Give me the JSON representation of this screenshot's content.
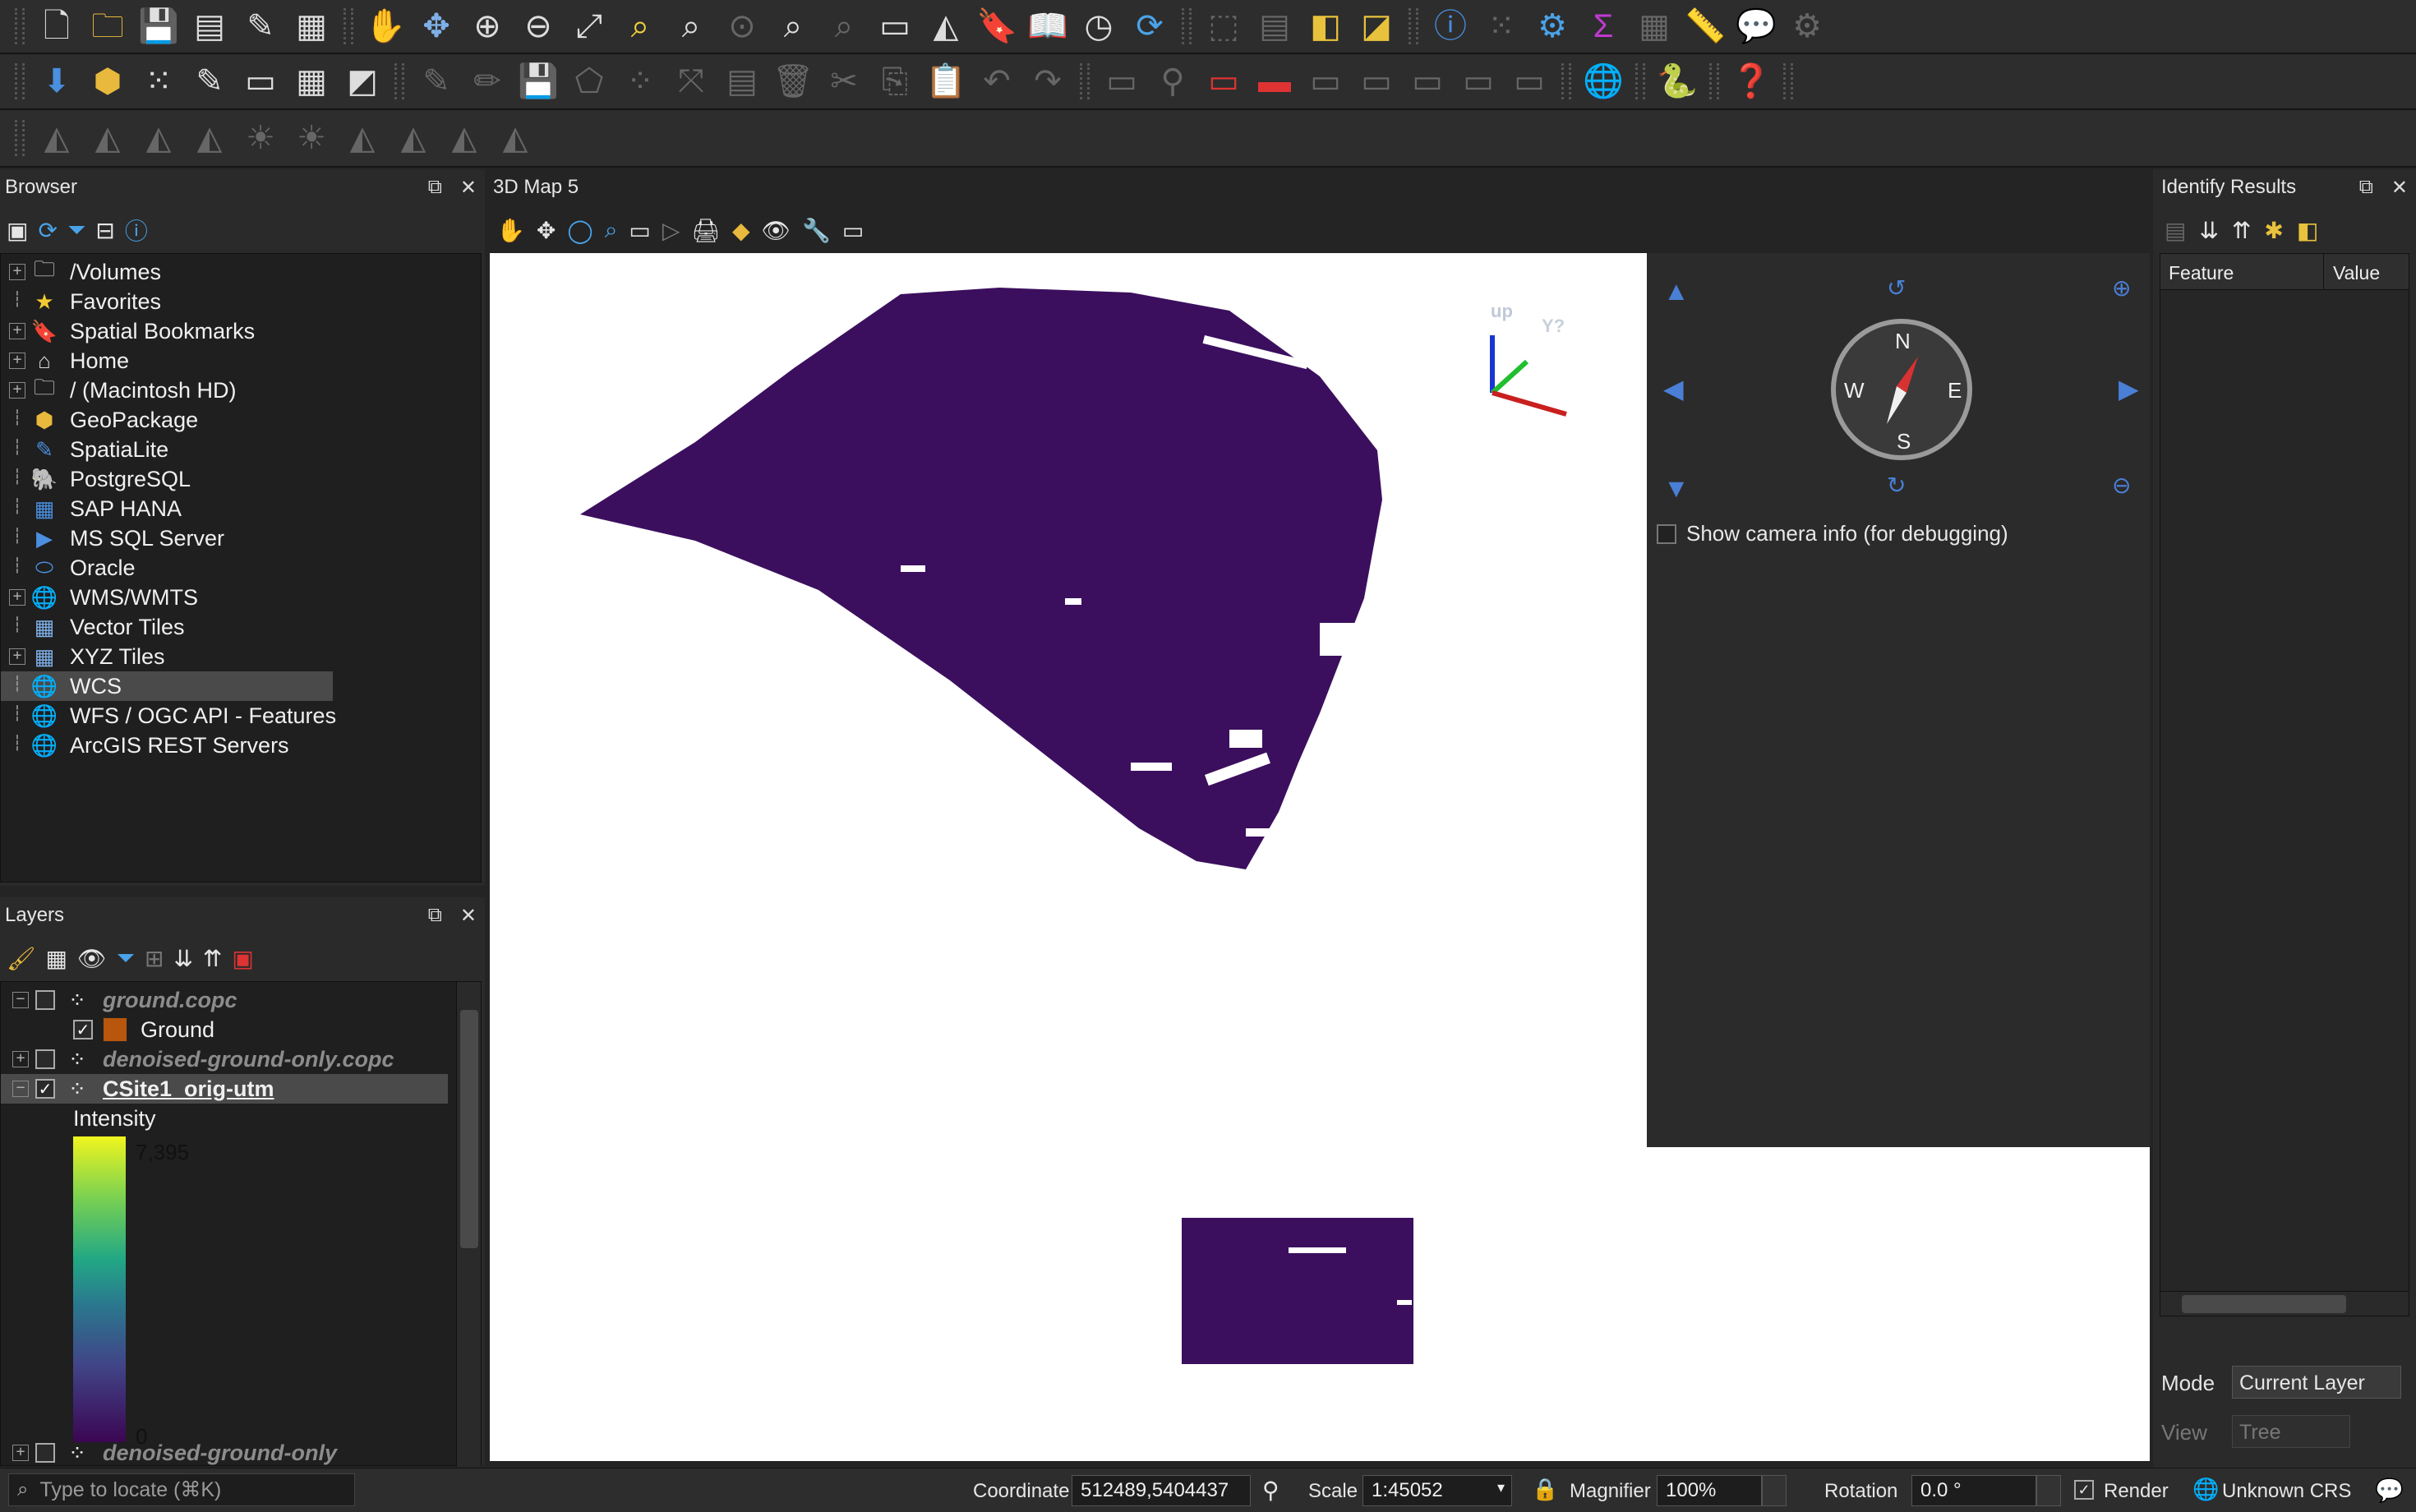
{
  "toolbar_rows": [
    {
      "icons": [
        "new-project-icon",
        "open-project-icon",
        "save-project-icon",
        "new-print-layout-icon",
        "style-manager-icon",
        "pan-map-icon",
        "pan-to-selection-icon",
        "zoom-in-icon",
        "zoom-out-icon",
        "zoom-full-icon",
        "zoom-to-layer-icon",
        "zoom-to-selection-icon",
        "zoom-native-icon",
        "zoom-last-icon",
        "zoom-next-icon",
        "new-map-view-icon",
        "new-3d-map-view-icon",
        "bookmark-icon",
        "show-bookmarks-icon",
        "temporal-controller-icon",
        "refresh-icon",
        "select-features-icon",
        "attribute-table-icon",
        "deselect-icon",
        "select-by-location-icon",
        "identify-icon",
        "measure-icon",
        "statistics-icon",
        "sum-icon",
        "open-field-calculator-icon",
        "ruler-icon",
        "map-tips-icon",
        "processing-icon"
      ]
    }
  ],
  "browser": {
    "title": "Browser",
    "items": [
      {
        "label": "/Volumes",
        "icon": "folder-icon",
        "expandable": true
      },
      {
        "label": "Favorites",
        "icon": "star-icon",
        "expandable": false
      },
      {
        "label": "Spatial Bookmarks",
        "icon": "bookmark-icon",
        "expandable": true
      },
      {
        "label": "Home",
        "icon": "home-icon",
        "expandable": true
      },
      {
        "label": "/ (Macintosh HD)",
        "icon": "folder-icon",
        "expandable": true
      },
      {
        "label": "GeoPackage",
        "icon": "geopackage-icon",
        "expandable": false
      },
      {
        "label": "SpatiaLite",
        "icon": "spatialite-icon",
        "expandable": false
      },
      {
        "label": "PostgreSQL",
        "icon": "postgresql-icon",
        "expandable": false
      },
      {
        "label": "SAP HANA",
        "icon": "sap-hana-icon",
        "expandable": false
      },
      {
        "label": "MS SQL Server",
        "icon": "mssql-icon",
        "expandable": false
      },
      {
        "label": "Oracle",
        "icon": "oracle-icon",
        "expandable": false
      },
      {
        "label": "WMS/WMTS",
        "icon": "wms-icon",
        "expandable": true
      },
      {
        "label": "Vector Tiles",
        "icon": "vector-tiles-icon",
        "expandable": false
      },
      {
        "label": "XYZ Tiles",
        "icon": "xyz-tiles-icon",
        "expandable": true
      },
      {
        "label": "WCS",
        "icon": "wcs-icon",
        "expandable": false,
        "selected": true
      },
      {
        "label": "WFS / OGC API - Features",
        "icon": "wfs-icon",
        "expandable": false
      },
      {
        "label": "ArcGIS REST Servers",
        "icon": "arcgis-icon",
        "expandable": false
      }
    ]
  },
  "layers": {
    "title": "Layers",
    "rows": [
      {
        "label": "ground.copc",
        "checked": false,
        "style": "italic",
        "indent": 0
      },
      {
        "label": "Ground",
        "checked": true,
        "style": "normal",
        "indent": 1,
        "swatch": "#b8560d"
      },
      {
        "label": "denoised-ground-only.copc",
        "checked": false,
        "style": "italic",
        "indent": 0
      },
      {
        "label": "CSite1_orig-utm",
        "checked": true,
        "style": "bold",
        "indent": 0
      },
      {
        "label": "Intensity",
        "style": "plain",
        "indent": 1
      }
    ],
    "ramp_max": "7,395",
    "ramp_min": "0",
    "next_layer": "denoised-ground-only"
  },
  "map3d": {
    "title": "3D Map 5",
    "axis_up": "up",
    "axis_y": "Y?",
    "compass": {
      "n": "N",
      "s": "S",
      "e": "E",
      "w": "W"
    },
    "camera_info_label": "Show camera info (for debugging)",
    "camera_info_checked": false
  },
  "identify": {
    "title": "Identify Results",
    "col_feature": "Feature",
    "col_value": "Value",
    "mode_label": "Mode",
    "mode_value": "Current Layer",
    "view_label": "View",
    "view_value": "Tree"
  },
  "status": {
    "locate_placeholder": "Type to locate (⌘K)",
    "coordinate_label": "Coordinate",
    "coordinate_value": "512489,5404437",
    "scale_label": "Scale",
    "scale_value": "1:45052",
    "magnifier_label": "Magnifier",
    "magnifier_value": "100%",
    "rotation_label": "Rotation",
    "rotation_value": "0.0 °",
    "render_label": "Render",
    "render_checked": true,
    "crs_label": "Unknown CRS"
  },
  "colors": {
    "point_cloud": "#3b0f5e",
    "ramp_top": "#f0f51e",
    "ramp_bottom": "#3b0653",
    "ground_swatch": "#b8560d"
  }
}
